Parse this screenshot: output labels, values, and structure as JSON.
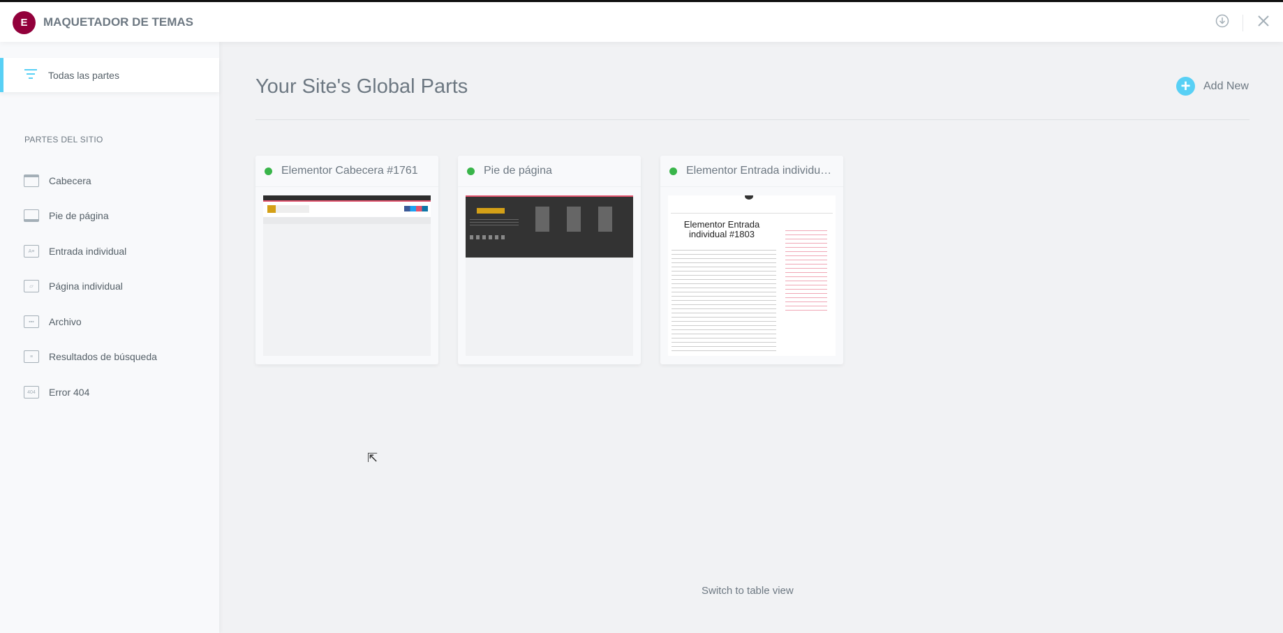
{
  "header": {
    "logo_letter": "E",
    "title": "MAQUETADOR DE TEMAS",
    "icons": [
      "download-circle-icon",
      "close-icon"
    ],
    "brand_color": "#92003b"
  },
  "sidebar": {
    "active": {
      "label": "Todas las partes",
      "icon": "filter-icon"
    },
    "section_label": "PARTES DEL SITIO",
    "items": [
      {
        "label": "Cabecera",
        "icon": "header-icon"
      },
      {
        "label": "Pie de página",
        "icon": "footer-icon"
      },
      {
        "label": "Entrada individual",
        "icon": "single-post-icon"
      },
      {
        "label": "Página individual",
        "icon": "single-page-icon"
      },
      {
        "label": "Archivo",
        "icon": "archive-icon"
      },
      {
        "label": "Resultados de búsqueda",
        "icon": "search-results-icon"
      },
      {
        "label": "Error 404",
        "icon": "error-404-icon",
        "glyph": "404"
      }
    ]
  },
  "main": {
    "title": "Your Site's Global Parts",
    "add_new": "Add New",
    "switch_view": "Switch to table view",
    "cards": [
      {
        "title": "Elementor Cabecera #1761",
        "status": "active"
      },
      {
        "title": "Pie de página",
        "status": "active"
      },
      {
        "title": "Elementor Entrada individual #1803",
        "status": "active",
        "preview_heading": "Elementor Entrada individual #1803"
      }
    ]
  },
  "accent_color": "#58d0f5",
  "status_color": "#39b54a"
}
